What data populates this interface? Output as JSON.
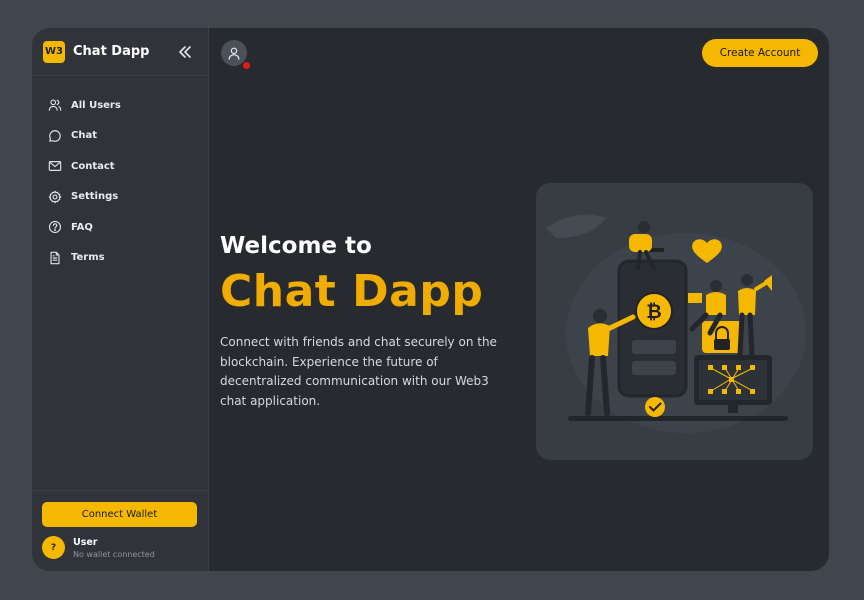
{
  "app": {
    "logo_text": "W3",
    "name": "Chat Dapp"
  },
  "sidebar": {
    "items": [
      {
        "label": "All Users",
        "icon": "users-icon"
      },
      {
        "label": "Chat",
        "icon": "chat-icon"
      },
      {
        "label": "Contact",
        "icon": "mail-icon"
      },
      {
        "label": "Settings",
        "icon": "gear-icon"
      },
      {
        "label": "FAQ",
        "icon": "help-icon"
      },
      {
        "label": "Terms",
        "icon": "document-icon"
      }
    ],
    "connect_label": "Connect Wallet",
    "user": {
      "avatar_text": "?",
      "name": "User",
      "status": "No wallet connected"
    }
  },
  "header": {
    "create_label": "Create Account"
  },
  "hero": {
    "welcome": "Welcome to",
    "title": "Chat Dapp",
    "description": "Connect with friends and chat securely on the blockchain. Experience the future of decentralized communication with our Web3 chat application."
  },
  "colors": {
    "accent": "#f5b800",
    "background": "#3f464e",
    "panel": "#272a2f",
    "sidebar": "#30343a",
    "status_dot": "#e21b1b"
  }
}
